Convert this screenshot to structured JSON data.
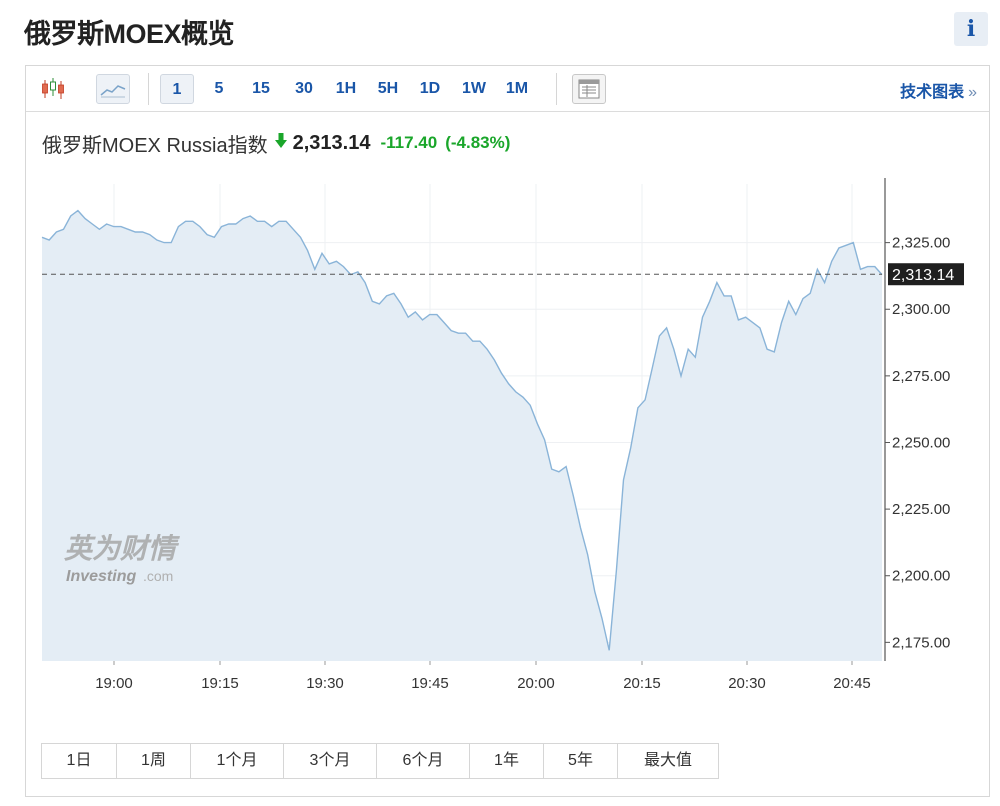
{
  "page": {
    "title": "俄罗斯MOEX概览",
    "info_label": "i"
  },
  "toolbar": {
    "intervals": [
      "1",
      "5",
      "15",
      "30",
      "1H",
      "5H",
      "1D",
      "1W",
      "1M"
    ],
    "active_interval": "1",
    "tech_chart_label": "技术图表",
    "tech_chart_arrow": "»"
  },
  "quote": {
    "name": "俄罗斯MOEX Russia指数",
    "price": "2,313.14",
    "change": "-117.40",
    "change_pct": "(-4.83%)",
    "direction": "down",
    "change_color": "#1aa62a"
  },
  "watermark": {
    "cn": "英为财情",
    "en": "Investing",
    "en_suffix": ".com"
  },
  "chart_data": {
    "type": "area",
    "x_ticks": [
      "19:00",
      "19:15",
      "19:30",
      "19:45",
      "20:00",
      "20:15",
      "20:30",
      "20:45"
    ],
    "y_ticks": [
      "2,325.00",
      "2,300.00",
      "2,275.00",
      "2,250.00",
      "2,225.00",
      "2,200.00",
      "2,175.00"
    ],
    "ylim": [
      2168,
      2347
    ],
    "last_value": 2313.14,
    "last_value_label": "2,313.14",
    "line_color": "#8ab4d8",
    "fill_color": "#e4edf5",
    "series": [
      {
        "values": [
          2327,
          2326,
          2329,
          2330,
          2335,
          2337,
          2334,
          2332,
          2330,
          2332,
          2331,
          2331,
          2330,
          2329,
          2329,
          2328,
          2326,
          2325,
          2325,
          2331,
          2333,
          2333,
          2331,
          2328,
          2327,
          2331,
          2332,
          2332,
          2334,
          2335,
          2333,
          2333,
          2331,
          2333,
          2333,
          2330,
          2327,
          2322,
          2315,
          2321,
          2317,
          2318,
          2316,
          2313,
          2314,
          2310,
          2303,
          2302,
          2305,
          2306,
          2302,
          2297,
          2299,
          2296,
          2298,
          2298,
          2295,
          2292,
          2291,
          2291,
          2288,
          2288,
          2285,
          2281,
          2276,
          2272,
          2269,
          2267,
          2264,
          2257,
          2251,
          2240,
          2239,
          2241,
          2230,
          2218,
          2208,
          2194,
          2184,
          2172,
          2202,
          2236,
          2248,
          2263,
          2266,
          2278,
          2290,
          2293,
          2285,
          2275,
          2285,
          2282,
          2297,
          2303,
          2310,
          2305,
          2305,
          2296,
          2297,
          2295,
          2293,
          2285,
          2284,
          2295,
          2303,
          2298,
          2304,
          2306,
          2315,
          2310,
          2318,
          2323,
          2324,
          2325,
          2315,
          2316,
          2316,
          2313
        ]
      }
    ]
  }
}
